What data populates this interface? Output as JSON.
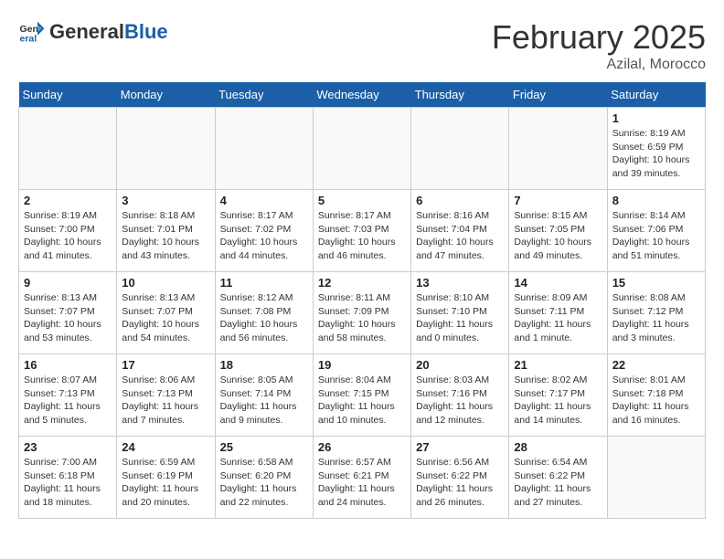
{
  "header": {
    "logo_general": "General",
    "logo_blue": "Blue",
    "month_title": "February 2025",
    "location": "Azilal, Morocco"
  },
  "weekdays": [
    "Sunday",
    "Monday",
    "Tuesday",
    "Wednesday",
    "Thursday",
    "Friday",
    "Saturday"
  ],
  "weeks": [
    [
      {
        "day": "",
        "info": ""
      },
      {
        "day": "",
        "info": ""
      },
      {
        "day": "",
        "info": ""
      },
      {
        "day": "",
        "info": ""
      },
      {
        "day": "",
        "info": ""
      },
      {
        "day": "",
        "info": ""
      },
      {
        "day": "1",
        "info": "Sunrise: 8:19 AM\nSunset: 6:59 PM\nDaylight: 10 hours\nand 39 minutes."
      }
    ],
    [
      {
        "day": "2",
        "info": "Sunrise: 8:19 AM\nSunset: 7:00 PM\nDaylight: 10 hours\nand 41 minutes."
      },
      {
        "day": "3",
        "info": "Sunrise: 8:18 AM\nSunset: 7:01 PM\nDaylight: 10 hours\nand 43 minutes."
      },
      {
        "day": "4",
        "info": "Sunrise: 8:17 AM\nSunset: 7:02 PM\nDaylight: 10 hours\nand 44 minutes."
      },
      {
        "day": "5",
        "info": "Sunrise: 8:17 AM\nSunset: 7:03 PM\nDaylight: 10 hours\nand 46 minutes."
      },
      {
        "day": "6",
        "info": "Sunrise: 8:16 AM\nSunset: 7:04 PM\nDaylight: 10 hours\nand 47 minutes."
      },
      {
        "day": "7",
        "info": "Sunrise: 8:15 AM\nSunset: 7:05 PM\nDaylight: 10 hours\nand 49 minutes."
      },
      {
        "day": "8",
        "info": "Sunrise: 8:14 AM\nSunset: 7:06 PM\nDaylight: 10 hours\nand 51 minutes."
      }
    ],
    [
      {
        "day": "9",
        "info": "Sunrise: 8:13 AM\nSunset: 7:07 PM\nDaylight: 10 hours\nand 53 minutes."
      },
      {
        "day": "10",
        "info": "Sunrise: 8:13 AM\nSunset: 7:07 PM\nDaylight: 10 hours\nand 54 minutes."
      },
      {
        "day": "11",
        "info": "Sunrise: 8:12 AM\nSunset: 7:08 PM\nDaylight: 10 hours\nand 56 minutes."
      },
      {
        "day": "12",
        "info": "Sunrise: 8:11 AM\nSunset: 7:09 PM\nDaylight: 10 hours\nand 58 minutes."
      },
      {
        "day": "13",
        "info": "Sunrise: 8:10 AM\nSunset: 7:10 PM\nDaylight: 11 hours\nand 0 minutes."
      },
      {
        "day": "14",
        "info": "Sunrise: 8:09 AM\nSunset: 7:11 PM\nDaylight: 11 hours\nand 1 minute."
      },
      {
        "day": "15",
        "info": "Sunrise: 8:08 AM\nSunset: 7:12 PM\nDaylight: 11 hours\nand 3 minutes."
      }
    ],
    [
      {
        "day": "16",
        "info": "Sunrise: 8:07 AM\nSunset: 7:13 PM\nDaylight: 11 hours\nand 5 minutes."
      },
      {
        "day": "17",
        "info": "Sunrise: 8:06 AM\nSunset: 7:13 PM\nDaylight: 11 hours\nand 7 minutes."
      },
      {
        "day": "18",
        "info": "Sunrise: 8:05 AM\nSunset: 7:14 PM\nDaylight: 11 hours\nand 9 minutes."
      },
      {
        "day": "19",
        "info": "Sunrise: 8:04 AM\nSunset: 7:15 PM\nDaylight: 11 hours\nand 10 minutes."
      },
      {
        "day": "20",
        "info": "Sunrise: 8:03 AM\nSunset: 7:16 PM\nDaylight: 11 hours\nand 12 minutes."
      },
      {
        "day": "21",
        "info": "Sunrise: 8:02 AM\nSunset: 7:17 PM\nDaylight: 11 hours\nand 14 minutes."
      },
      {
        "day": "22",
        "info": "Sunrise: 8:01 AM\nSunset: 7:18 PM\nDaylight: 11 hours\nand 16 minutes."
      }
    ],
    [
      {
        "day": "23",
        "info": "Sunrise: 7:00 AM\nSunset: 6:18 PM\nDaylight: 11 hours\nand 18 minutes."
      },
      {
        "day": "24",
        "info": "Sunrise: 6:59 AM\nSunset: 6:19 PM\nDaylight: 11 hours\nand 20 minutes."
      },
      {
        "day": "25",
        "info": "Sunrise: 6:58 AM\nSunset: 6:20 PM\nDaylight: 11 hours\nand 22 minutes."
      },
      {
        "day": "26",
        "info": "Sunrise: 6:57 AM\nSunset: 6:21 PM\nDaylight: 11 hours\nand 24 minutes."
      },
      {
        "day": "27",
        "info": "Sunrise: 6:56 AM\nSunset: 6:22 PM\nDaylight: 11 hours\nand 26 minutes."
      },
      {
        "day": "28",
        "info": "Sunrise: 6:54 AM\nSunset: 6:22 PM\nDaylight: 11 hours\nand 27 minutes."
      },
      {
        "day": "",
        "info": ""
      }
    ]
  ]
}
